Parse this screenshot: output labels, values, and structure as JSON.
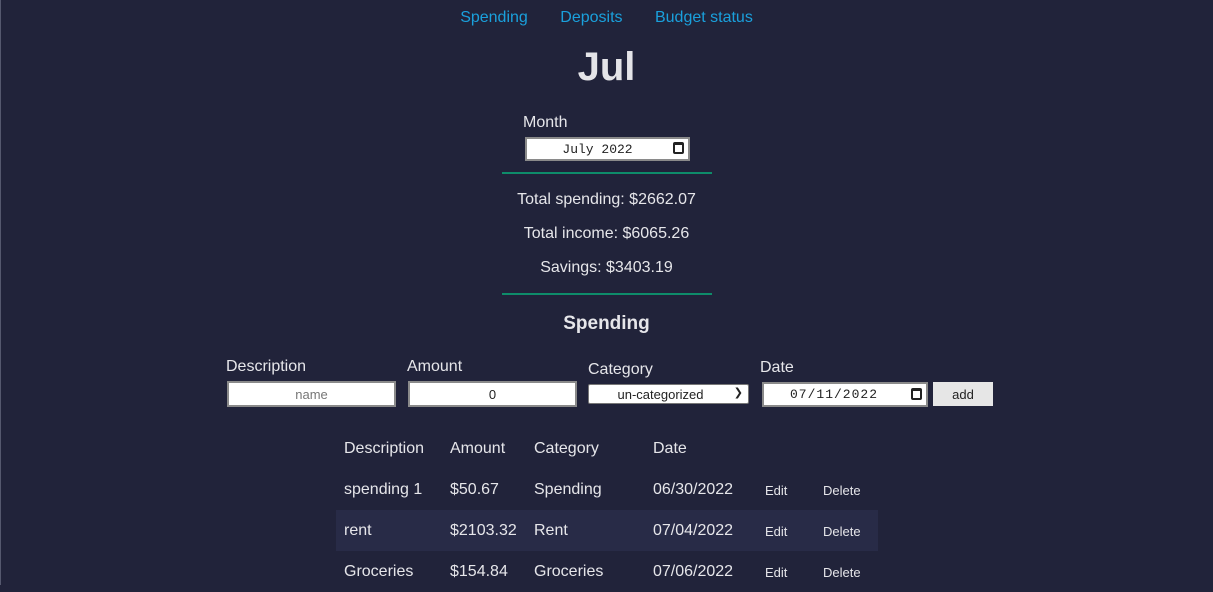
{
  "nav": {
    "items": [
      "Spending",
      "Deposits",
      "Budget status"
    ]
  },
  "page": {
    "title": "Jul"
  },
  "month": {
    "label": "Month",
    "value": "July 2022"
  },
  "stats": {
    "total_spending": "Total spending: $2662.07",
    "total_income": "Total income: $6065.26",
    "savings": "Savings: $3403.19"
  },
  "spending_section": {
    "title": "Spending"
  },
  "form": {
    "description_label": "Description",
    "description_placeholder": "name",
    "amount_label": "Amount",
    "amount_value": "0",
    "category_label": "Category",
    "category_value": "un-categorized",
    "date_label": "Date",
    "date_value": "07/11/2022",
    "add_label": "add"
  },
  "table": {
    "headers": [
      "Description",
      "Amount",
      "Category",
      "Date"
    ],
    "edit_label": "Edit",
    "delete_label": "Delete",
    "rows": [
      {
        "description": "spending 1",
        "amount": "$50.67",
        "category": "Spending",
        "date": "06/30/2022"
      },
      {
        "description": "rent",
        "amount": "$2103.32",
        "category": "Rent",
        "date": "07/04/2022"
      },
      {
        "description": "Groceries",
        "amount": "$154.84",
        "category": "Groceries",
        "date": "07/06/2022"
      }
    ]
  }
}
